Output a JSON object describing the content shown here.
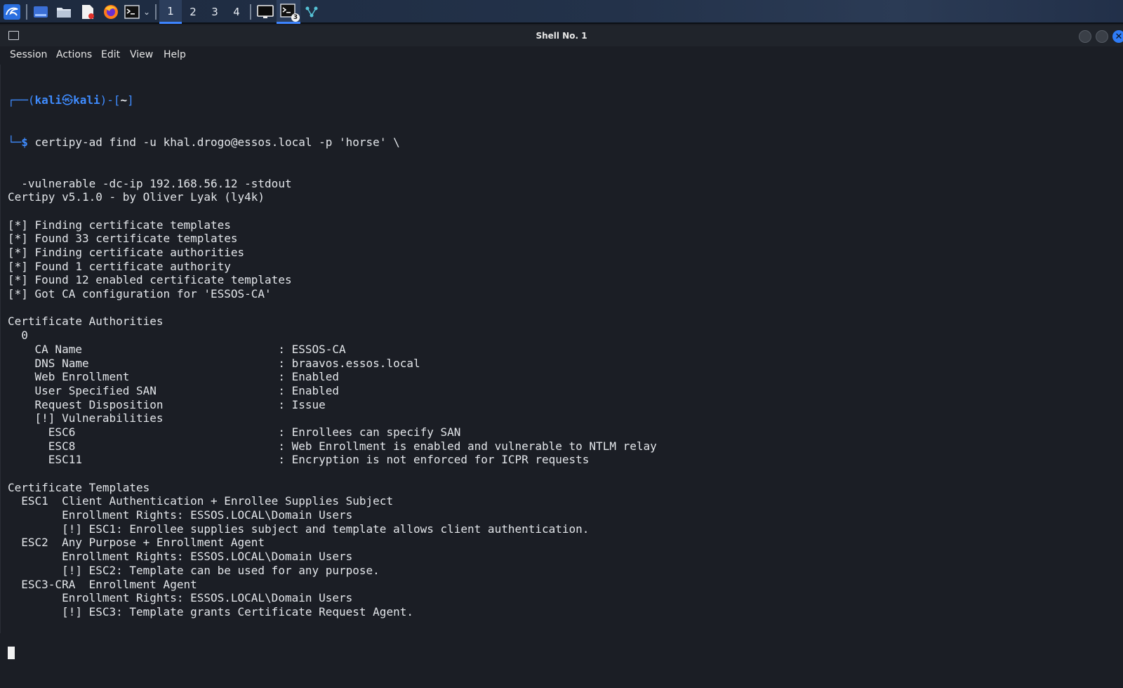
{
  "taskbar": {
    "workspaces": [
      "1",
      "2",
      "3",
      "4"
    ],
    "terminal_badge": "3",
    "icons": [
      "kali-dragon-icon",
      "desktop-icon",
      "file-manager-icon",
      "text-editor-icon",
      "firefox-icon",
      "terminal-icon",
      "chevron-down-icon",
      "screen-icon",
      "terminal-task-icon",
      "network-icon"
    ]
  },
  "window": {
    "title": "Shell No. 1",
    "close_glyph": "✕"
  },
  "menu": {
    "items": [
      "Session",
      "Actions",
      "Edit",
      "View",
      "Help"
    ]
  },
  "terminal": {
    "prompt": {
      "open": "┌──(",
      "user": "kali",
      "at": "㉿",
      "host": "kali",
      "close": ")-[",
      "dir": "~",
      "end": "]",
      "dollar_prefix": "└─",
      "dollar": "$"
    },
    "command_line1": " certipy-ad find -u khal.drogo@essos.local -p 'horse' \\",
    "output": [
      "  -vulnerable -dc-ip 192.168.56.12 -stdout",
      "Certipy v5.1.0 - by Oliver Lyak (ly4k)",
      "",
      "[*] Finding certificate templates",
      "[*] Found 33 certificate templates",
      "[*] Finding certificate authorities",
      "[*] Found 1 certificate authority",
      "[*] Found 12 enabled certificate templates",
      "[*] Got CA configuration for 'ESSOS-CA'",
      "",
      "Certificate Authorities",
      "  0",
      "    CA Name                             : ESSOS-CA",
      "    DNS Name                            : braavos.essos.local",
      "    Web Enrollment                      : Enabled",
      "    User Specified SAN                  : Enabled",
      "    Request Disposition                 : Issue",
      "    [!] Vulnerabilities",
      "      ESC6                              : Enrollees can specify SAN",
      "      ESC8                              : Web Enrollment is enabled and vulnerable to NTLM relay",
      "      ESC11                             : Encryption is not enforced for ICPR requests",
      "",
      "Certificate Templates",
      "  ESC1  Client Authentication + Enrollee Supplies Subject",
      "        Enrollment Rights: ESSOS.LOCAL\\Domain Users",
      "        [!] ESC1: Enrollee supplies subject and template allows client authentication.",
      "  ESC2  Any Purpose + Enrollment Agent",
      "        Enrollment Rights: ESSOS.LOCAL\\Domain Users",
      "        [!] ESC2: Template can be used for any purpose.",
      "  ESC3-CRA  Enrollment Agent",
      "        Enrollment Rights: ESSOS.LOCAL\\Domain Users",
      "        [!] ESC3: Template grants Certificate Request Agent."
    ]
  },
  "colors": {
    "accent": "#3d84ff",
    "prompt_blue": "#3f8cff",
    "terminal_bg": "#1b1e25",
    "terminal_fg": "#e3e6ea"
  }
}
